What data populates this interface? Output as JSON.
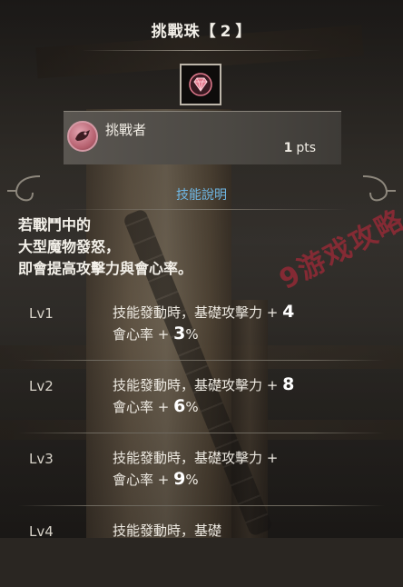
{
  "header": {
    "title_text": "挑戰珠",
    "bracket_open": "【",
    "level_number": "2",
    "bracket_close": "】"
  },
  "gem": {
    "icon": "diamond-gem-icon",
    "color": "#e27a8e"
  },
  "skill": {
    "icon": "challenger-skill-icon",
    "name": "挑戰者",
    "points": "1",
    "points_unit": "pts"
  },
  "section": {
    "heading": "技能說明"
  },
  "description": [
    "若戰鬥中的",
    "大型魔物發怒，",
    "即會提高攻擊力與會心率。"
  ],
  "levels": [
    {
      "label": "Lv1",
      "line1_prefix": "技能發動時，基礎攻擊力 + ",
      "line1_value": "4",
      "line2_prefix": "會心率 + ",
      "line2_value": "3",
      "line2_suffix": "%"
    },
    {
      "label": "Lv2",
      "line1_prefix": "技能發動時，基礎攻擊力 + ",
      "line1_value": "8",
      "line2_prefix": "會心率 + ",
      "line2_value": "6",
      "line2_suffix": "%"
    },
    {
      "label": "Lv3",
      "line1_prefix": "技能發動時，基礎攻擊力 + ",
      "line1_value": "",
      "line2_prefix": "會心率 + ",
      "line2_value": "9",
      "line2_suffix": "%"
    },
    {
      "label": "Lv4",
      "line1_prefix": "技能發動時，基礎",
      "line1_value": "",
      "line2_prefix": "",
      "line2_value": "",
      "line2_suffix": ""
    }
  ],
  "watermark": {
    "text": "9游戏攻略",
    "color": "#c8283c"
  },
  "colors": {
    "section_heading": "#6fb8e6",
    "accent_pink": "#d39aa5"
  }
}
